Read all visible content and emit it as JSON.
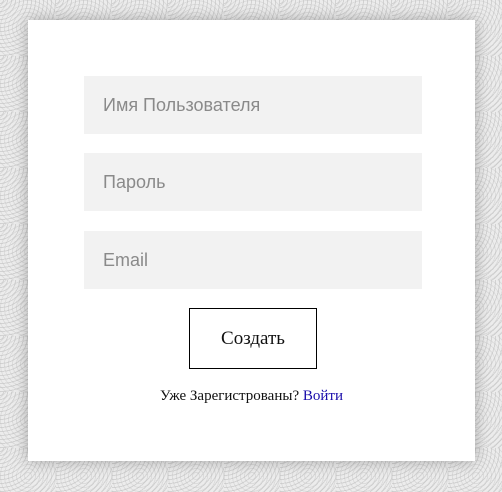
{
  "form": {
    "username_placeholder": "Имя Пользователя",
    "password_placeholder": "Пароль",
    "email_placeholder": "Email",
    "submit_label": "Создать",
    "already_registered_text": "Уже Зарегистрованы?",
    "login_link_label": "Войти"
  },
  "colors": {
    "field_background": "#f2f2f2",
    "link": "#1a0dab",
    "card_background": "#ffffff"
  }
}
